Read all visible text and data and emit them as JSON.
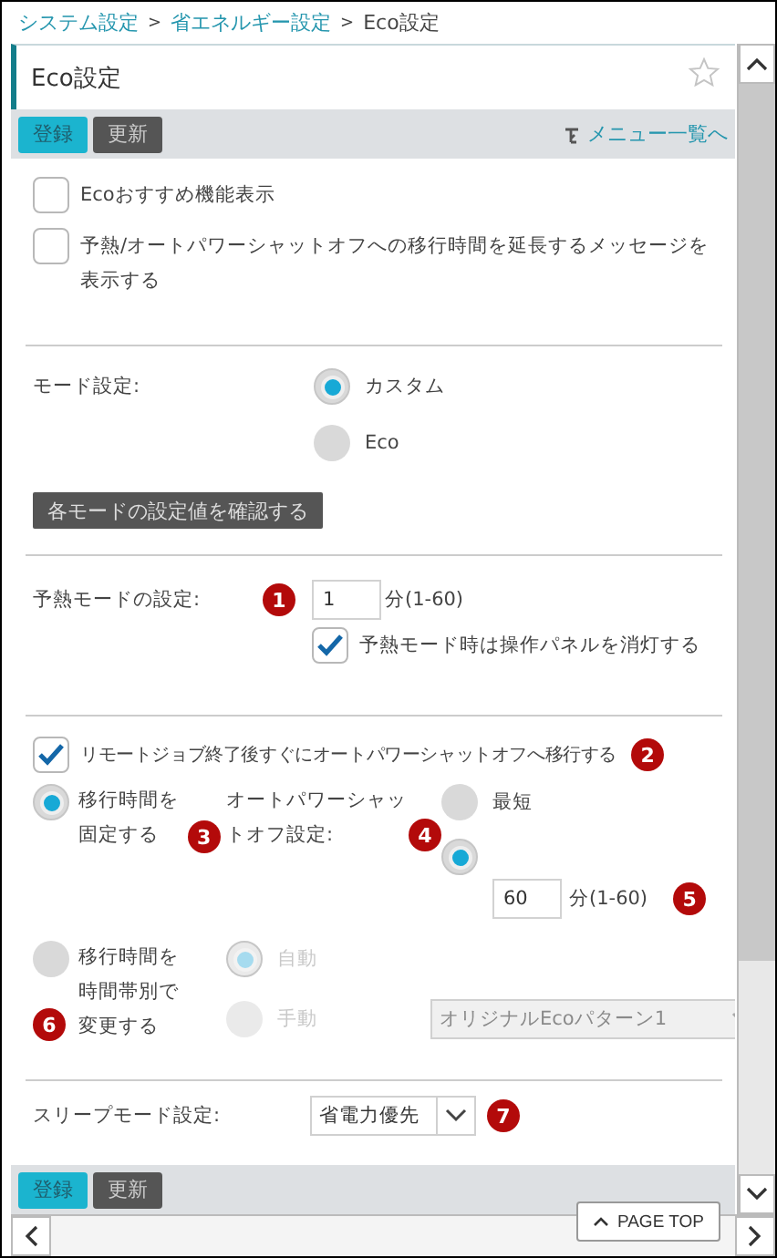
{
  "breadcrumb": [
    {
      "label": "システム設定",
      "current": false
    },
    {
      "label": "省エネルギー設定",
      "current": false
    },
    {
      "label": "Eco設定",
      "current": true
    }
  ],
  "breadcrumb_separator": ">",
  "title": "Eco設定",
  "toolbar": {
    "buttons": [
      {
        "label": "登録",
        "kind": "primary"
      },
      {
        "label": "更新",
        "kind": "secondary"
      }
    ],
    "menu_link": "メニュー一覧へ"
  },
  "options": [
    {
      "label": "Ecoおすすめ機能表示",
      "checked": false
    },
    {
      "label": "予熱/オートパワーシャットオフへの移行時間を延長するメッセージを表示する",
      "checked": false
    }
  ],
  "mode": {
    "label": "モード設定:",
    "radios": [
      {
        "label": "カスタム",
        "selected": true
      },
      {
        "label": "Eco",
        "selected": false
      }
    ],
    "confirm_button": "各モードの設定値を確認する"
  },
  "preheat": {
    "label": "予熱モードの設定:",
    "badge": "1",
    "value": "1",
    "unit": "分(1-60)",
    "checkbox": {
      "label": "予熱モード時は操作パネルを消灯する",
      "checked": true
    }
  },
  "remote": {
    "label": "リモートジョブ終了後すぐにオートパワーシャットオフへ移行する",
    "checked": true,
    "badge": "2"
  },
  "fixed": {
    "label": "移行時間を固定する",
    "selected": true,
    "badge": "3",
    "setting_label": "オートパワーシャットオフ設定:",
    "setting_badge": "4",
    "options": [
      {
        "label": "最短",
        "selected": false
      },
      {
        "selected": true,
        "value": "60",
        "unit": "分(1-60)",
        "badge": "5"
      }
    ]
  },
  "timezone": {
    "label": "移行時間を時間帯別で変更する",
    "selected": false,
    "badge": "6",
    "disabled": true,
    "options": [
      {
        "label": "自動",
        "selected": true
      },
      {
        "label": "手動",
        "selected": false
      }
    ],
    "pattern": "オリジナルEcoパターン1"
  },
  "sleep": {
    "label": "スリープモード設定:",
    "value": "省電力優先",
    "badge": "7"
  },
  "bottom_toolbar": {
    "buttons": [
      {
        "label": "登録",
        "kind": "primary"
      },
      {
        "label": "更新",
        "kind": "secondary"
      }
    ]
  },
  "page_top": "PAGE TOP"
}
